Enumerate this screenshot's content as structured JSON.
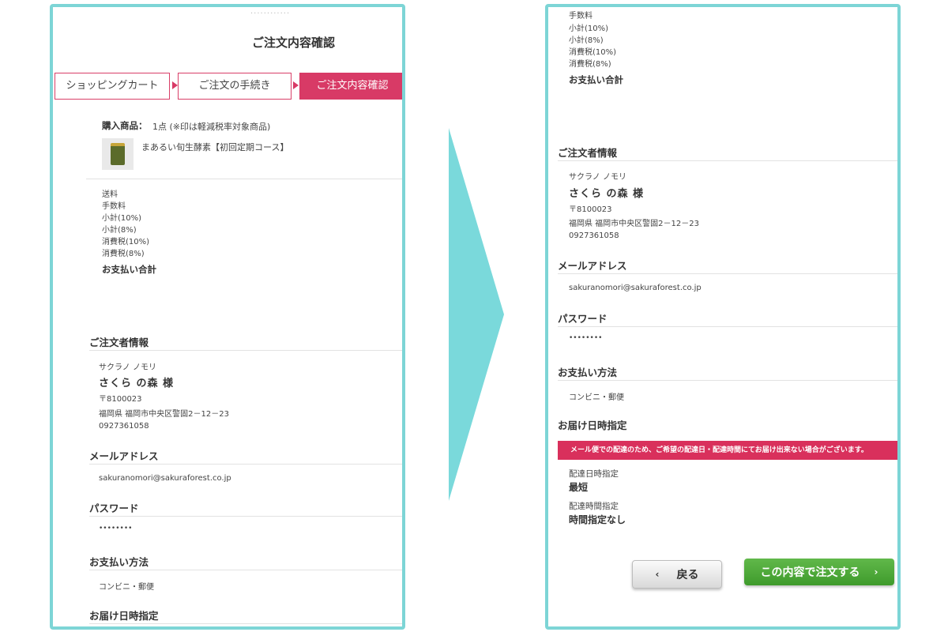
{
  "header": {
    "dots": "............",
    "title": "ご注文内容確認"
  },
  "steps": [
    {
      "label": "ショッピングカート"
    },
    {
      "label": "ご注文の手続き"
    },
    {
      "label": "ご注文内容確認"
    }
  ],
  "purchase": {
    "label": "購入商品：",
    "summary": "1点 (※印は軽減税率対象商品)",
    "product_name": "まあるい旬生酵素【初回定期コース】"
  },
  "fees": {
    "shipping": "送料",
    "handling": "手数料",
    "subtotal10": "小計(10%)",
    "subtotal8": "小計(8%)",
    "tax10": "消費税(10%)",
    "tax8": "消費税(8%)",
    "total": "お支払い合計"
  },
  "customer": {
    "heading": "ご注文者情報",
    "kana": "サクラノ ノモリ",
    "name": "さくら の森 様",
    "postal": "〒8100023",
    "address": "福岡県 福岡市中央区警固2－12－23",
    "phone": "0927361058"
  },
  "email": {
    "heading": "メールアドレス",
    "value": "sakuranomori@sakuraforest.co.jp"
  },
  "password": {
    "heading": "パスワード",
    "value": "••••••••"
  },
  "payment": {
    "heading": "お支払い方法",
    "value": "コンビニ・郵便"
  },
  "delivery": {
    "heading": "お届け日時指定",
    "notice": "メール便での配達のため、ご希望の配達日・配達時間にてお届け出来ない場合がございます。",
    "date_label": "配達日時指定",
    "date_value": "最短",
    "time_label": "配達時間指定",
    "time_value": "時間指定なし"
  },
  "buttons": {
    "back_icon": "‹",
    "back": "戻る",
    "order": "この内容で注文する",
    "order_icon": "›"
  },
  "colors": {
    "frame": "#7dd5d6",
    "accent": "#d83a66",
    "order_button": "#4caa36"
  }
}
